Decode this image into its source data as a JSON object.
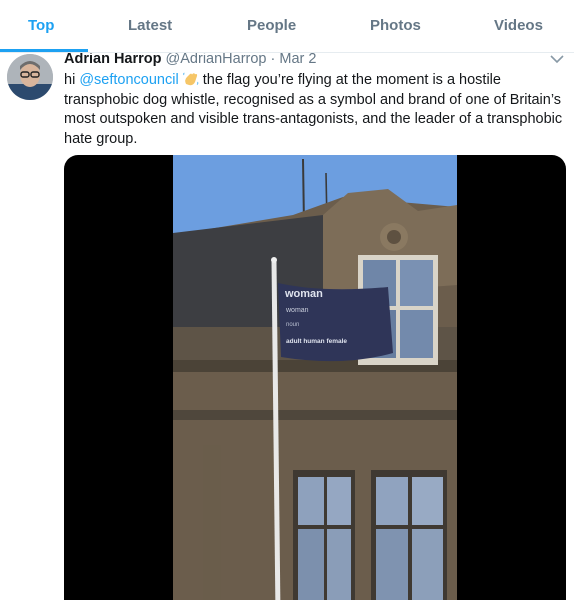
{
  "tabs": [
    {
      "label": "Top",
      "active": true
    },
    {
      "label": "Latest",
      "active": false
    },
    {
      "label": "People",
      "active": false
    },
    {
      "label": "Photos",
      "active": false
    },
    {
      "label": "Videos",
      "active": false
    }
  ],
  "tweet": {
    "author_name": "Adrian Harrop",
    "handle": "@AdrianHarrop",
    "separator": "·",
    "date": "Mar 2",
    "text_prefix": "hi ",
    "mention": "@seftoncouncil",
    "emoji": "waving-hand",
    "text_rest": " the flag you’re flying at the moment is a hostile transphobic dog whistle, recognised as a symbol and brand of one of Britain’s most outspoken and visible trans-antagonists, and the leader of a transphobic hate group."
  },
  "media": {
    "flag_lines": [
      "woman",
      "woman",
      "noun",
      "adult human female"
    ]
  },
  "colors": {
    "accent": "#1da1f2",
    "secondary_text": "#657786",
    "primary_text": "#14171a"
  }
}
